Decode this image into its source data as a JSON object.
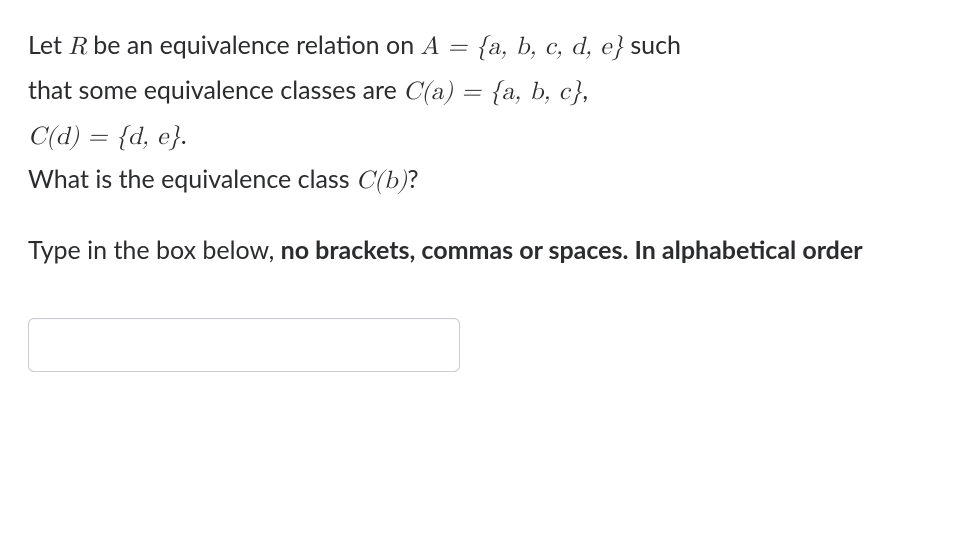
{
  "question": {
    "line1_pre": "Let ",
    "line1_R": "R",
    "line1_mid1": " be an equivalence relation on ",
    "line1_A": "A",
    "line1_eq": " = ",
    "line1_setA": "{a, b, c, d, e}",
    "line1_post": " such",
    "line2_pre": "that some equivalence classes are ",
    "line2_Ca": "C(a)",
    "line2_eq1": " = ",
    "line2_setCa": "{a, b, c}",
    "line2_comma": ",",
    "line3_Cd": "C(d)",
    "line3_eq": " = ",
    "line3_setCd": "{d, e}",
    "line3_period": ".",
    "line4_pre": "What is the equivalence class ",
    "line4_Cb": "C(b)",
    "line4_post": "?"
  },
  "instructions": {
    "pre": "Type in the box below, ",
    "bold": "no brackets, commas or spaces. In alphabetical order"
  },
  "answer": {
    "value": ""
  }
}
